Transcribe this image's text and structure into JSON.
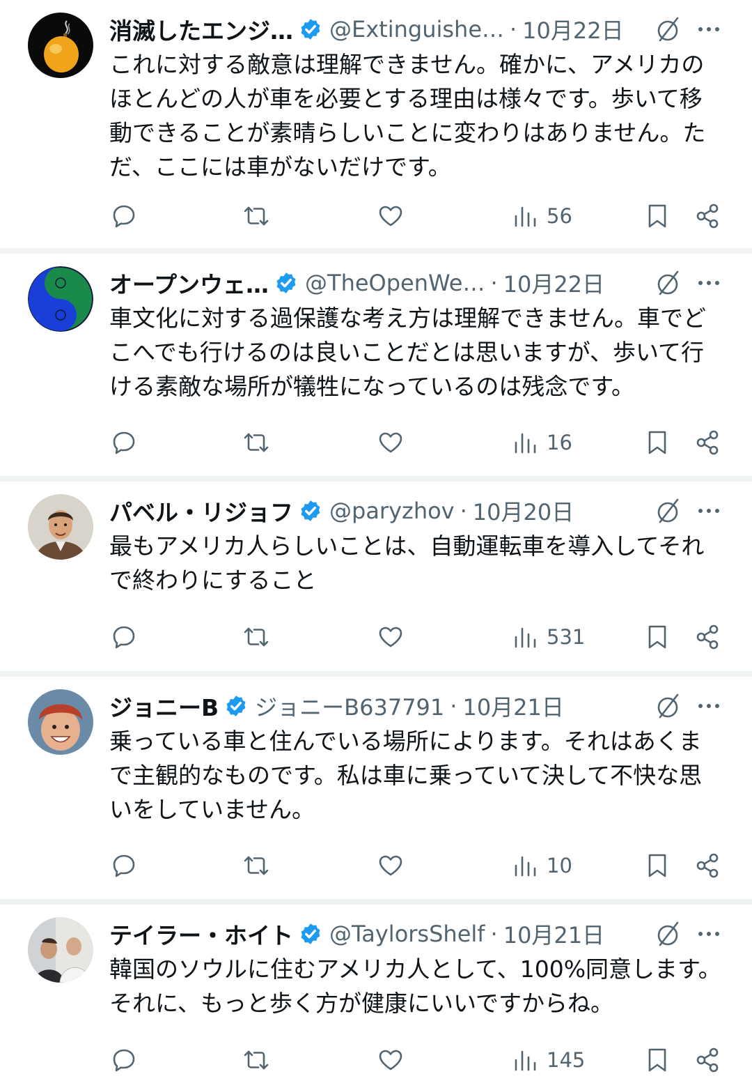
{
  "tweets": [
    {
      "name": "消滅したエンジ…",
      "handle": "@Extinguishe…",
      "date": "10月22日",
      "text": "これに対する敵意は理解できません。確かに、アメリカのほとんどの人が車を必要とする理由は様々です。歩いて移動できることが素晴らしいことに変わりはありません。ただ、ここには車がないだけです。",
      "views": "56"
    },
    {
      "name": "オープンウェ…",
      "handle": "@TheOpenWe…",
      "date": "10月22日",
      "text": "車文化に対する過保護な考え方は理解できません。車でどこへでも行けるのは良いことだとは思いますが、歩いて行ける素敵な場所が犠牲になっているのは残念です。",
      "views": "16"
    },
    {
      "name": "パベル・リジョフ",
      "handle": "@paryzhov",
      "date": "10月20日",
      "text": "最もアメリカ人らしいことは、自動運転車を導入してそれで終わりにすること",
      "views": "531"
    },
    {
      "name": "ジョニーB",
      "handle": "ジョニーB637791",
      "date": "10月21日",
      "text": "乗っている車と住んでいる場所によります。それはあくまで主観的なものです。私は車に乗っていて決して不快な思いをしていません。",
      "views": "10"
    },
    {
      "name": "テイラー・ホイト",
      "handle": "@TaylorsShelf",
      "date": "10月21日",
      "text": "韓国のソウルに住むアメリカ人として、100%同意します。それに、もっと歩く方が健康にいいですからね。",
      "views": "145"
    }
  ],
  "separator": "·",
  "icons": {
    "verified": "verified-badge-icon",
    "grok": "grok-icon",
    "more": "more-icon",
    "reply": "reply-icon",
    "retweet": "retweet-icon",
    "like": "like-icon",
    "views": "views-icon",
    "bookmark": "bookmark-icon",
    "share": "share-icon"
  },
  "colors": {
    "verified": "#1d9bf0",
    "secondary_text": "#536471",
    "separator": "#eff3f4"
  }
}
